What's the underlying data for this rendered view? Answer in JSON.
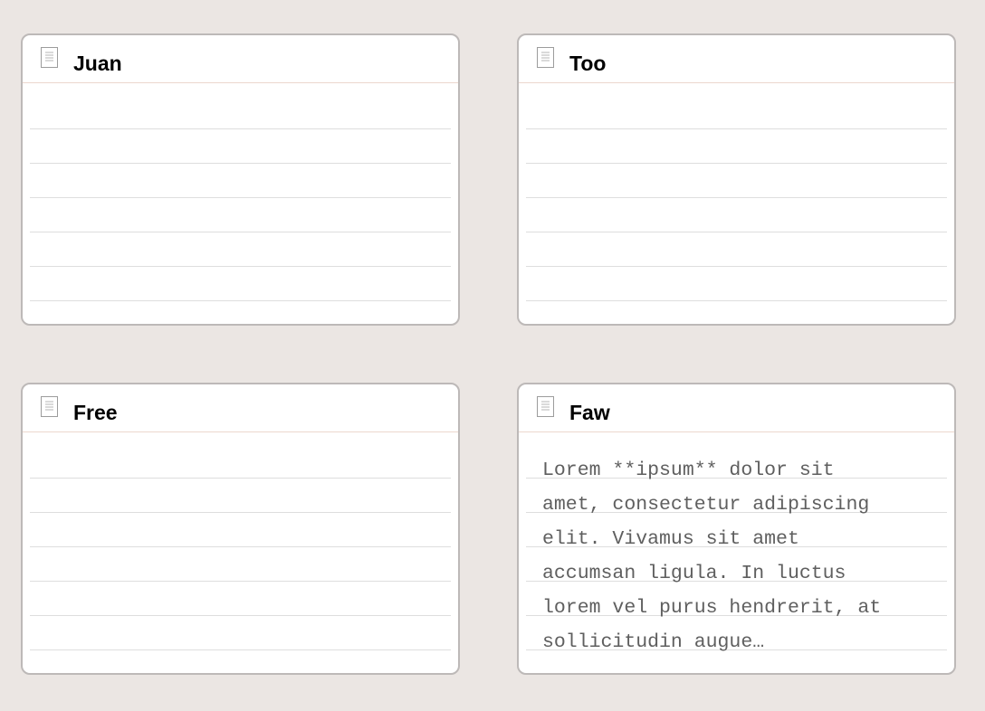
{
  "cards": [
    {
      "title": "Juan",
      "body": ""
    },
    {
      "title": "Too",
      "body": ""
    },
    {
      "title": "Free",
      "body": ""
    },
    {
      "title": "Faw",
      "body": "Lorem **ipsum** dolor sit\namet, consectetur adipiscing\nelit. Vivamus sit amet\naccumsan ligula. In luctus\nlorem vel purus hendrerit, at\nsollicitudin augue…"
    }
  ],
  "icons": {
    "card_icon": "document-icon"
  },
  "colors": {
    "background": "#ebe6e3",
    "card_background": "#ffffff",
    "card_border": "#bdb9b8",
    "header_divider": "#ecd7cd",
    "rule_line": "#dedede",
    "title_text": "#000000",
    "body_text": "#5f5f5f"
  }
}
